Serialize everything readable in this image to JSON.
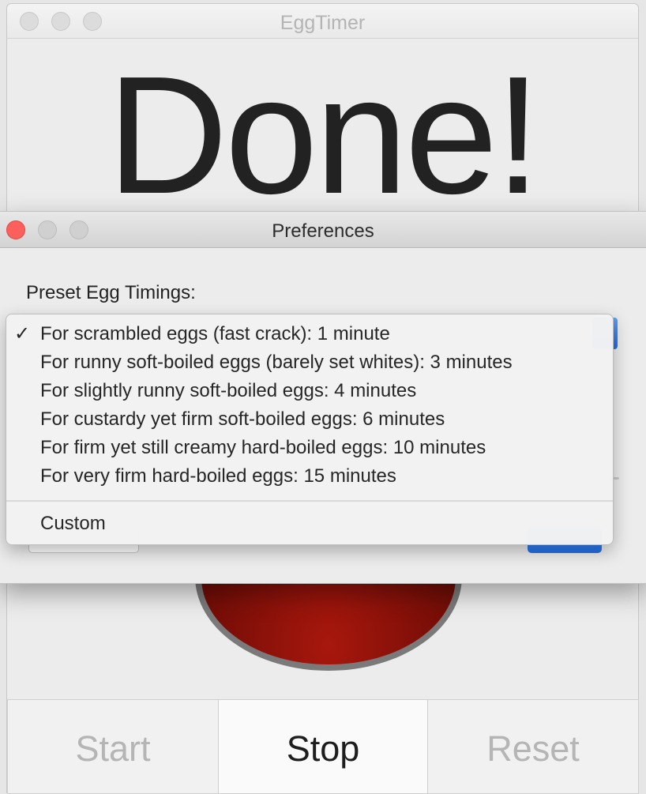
{
  "main_window": {
    "title": "EggTimer",
    "status_text": "Done!",
    "buttons": {
      "start": "Start",
      "stop": "Stop",
      "reset": "Reset"
    }
  },
  "preferences_window": {
    "title": "Preferences",
    "preset_label": "Preset Egg Timings:",
    "menu": {
      "check_mark": "✓",
      "items": [
        {
          "label": "For scrambled eggs (fast crack): 1 minute",
          "selected": true
        },
        {
          "label": "For runny soft-boiled eggs (barely set whites): 3 minutes",
          "selected": false
        },
        {
          "label": "For slightly runny soft-boiled eggs: 4 minutes",
          "selected": false
        },
        {
          "label": "For custardy yet firm soft-boiled eggs: 6 minutes",
          "selected": false
        },
        {
          "label": "For firm yet still creamy hard-boiled eggs: 10 minutes",
          "selected": false
        },
        {
          "label": "For very firm hard-boiled eggs: 15 minutes",
          "selected": false
        }
      ],
      "custom_label": "Custom"
    }
  },
  "colors": {
    "close_button": "#fc605c",
    "accent_blue": "#1f6ee8",
    "egg_red": "#a8170d"
  }
}
